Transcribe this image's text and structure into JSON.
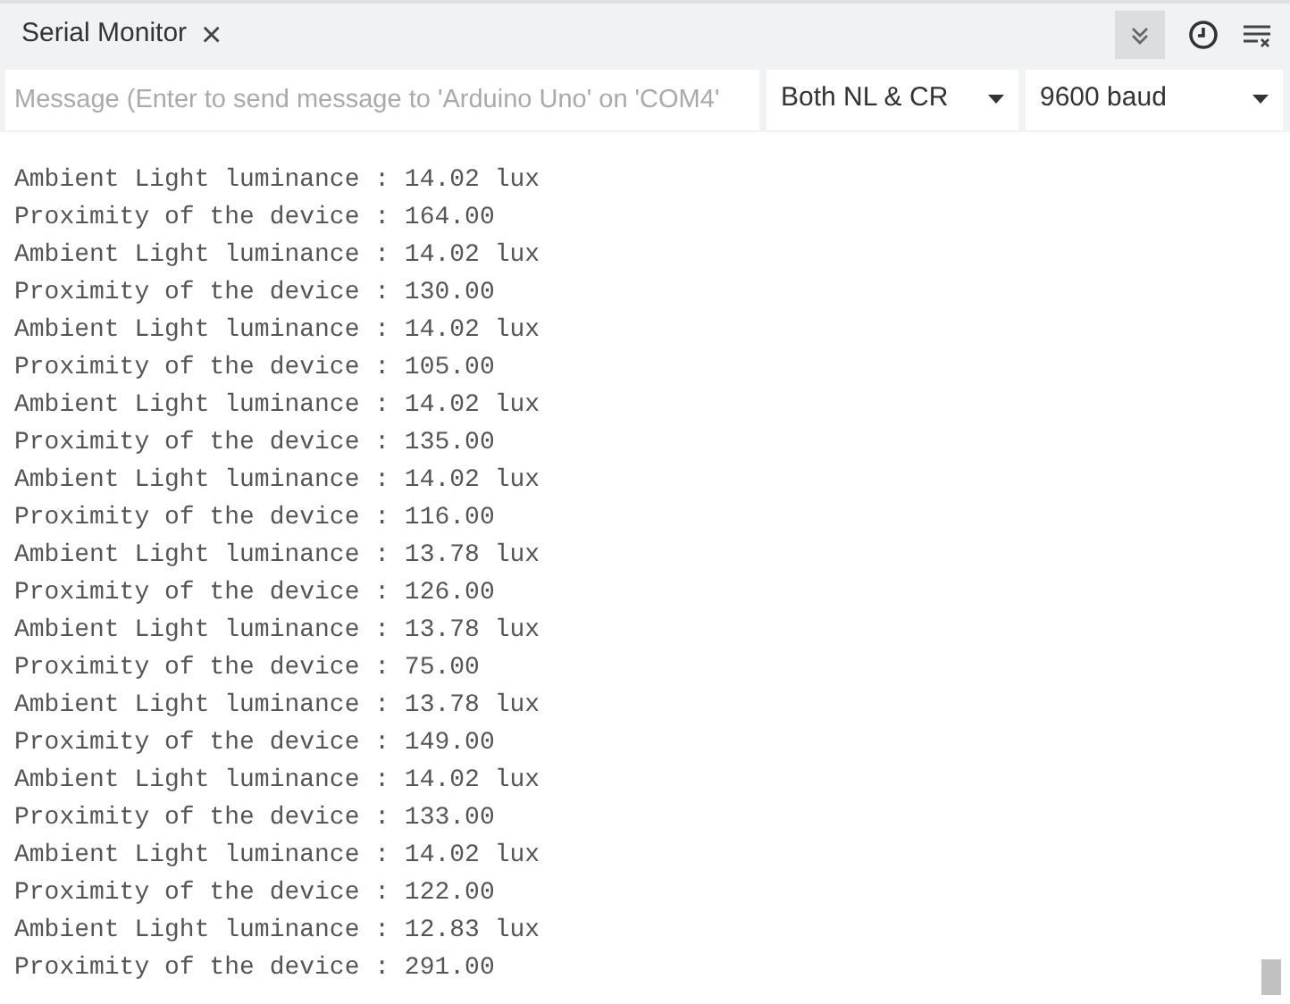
{
  "tab": {
    "title": "Serial Monitor",
    "close": "×"
  },
  "toolbar": {
    "autoscroll_selected": true
  },
  "message_field": {
    "placeholder": "Message (Enter to send message to 'Arduino Uno' on 'COM4'"
  },
  "line_ending": {
    "value": "Both NL & CR"
  },
  "baud_rate": {
    "value": "9600 baud"
  },
  "output_lines": [
    "Ambient Light luminance : 14.02 lux",
    "Proximity of the device : 164.00",
    "Ambient Light luminance : 14.02 lux",
    "Proximity of the device : 130.00",
    "Ambient Light luminance : 14.02 lux",
    "Proximity of the device : 105.00",
    "Ambient Light luminance : 14.02 lux",
    "Proximity of the device : 135.00",
    "Ambient Light luminance : 14.02 lux",
    "Proximity of the device : 116.00",
    "Ambient Light luminance : 13.78 lux",
    "Proximity of the device : 126.00",
    "Ambient Light luminance : 13.78 lux",
    "Proximity of the device : 75.00",
    "Ambient Light luminance : 13.78 lux",
    "Proximity of the device : 149.00",
    "Ambient Light luminance : 14.02 lux",
    "Proximity of the device : 133.00",
    "Ambient Light luminance : 14.02 lux",
    "Proximity of the device : 122.00",
    "Ambient Light luminance : 12.83 lux",
    "Proximity of the device : 291.00"
  ]
}
